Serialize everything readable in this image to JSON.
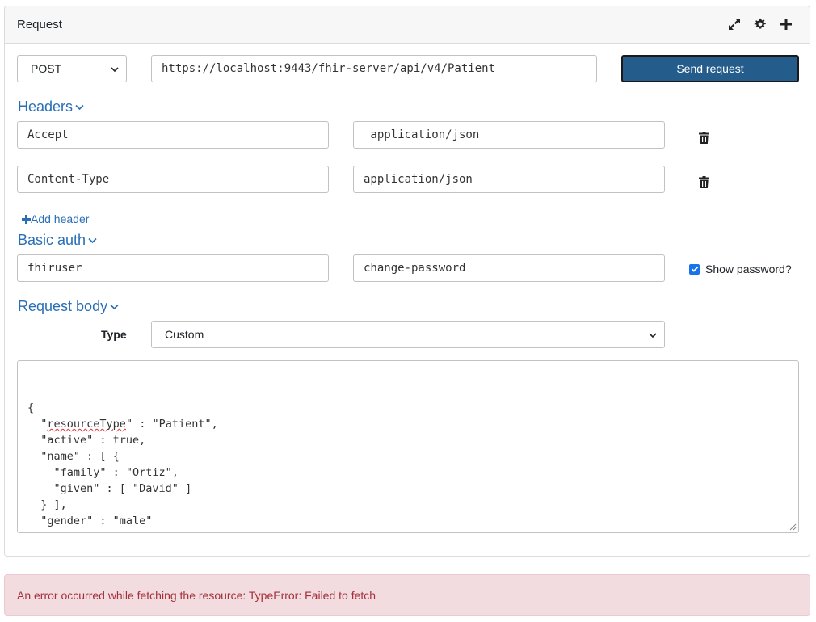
{
  "panel": {
    "title": "Request",
    "icons": [
      "expand-icon",
      "gear-icon",
      "plus-icon"
    ]
  },
  "request": {
    "method": "POST",
    "url": "https://localhost:9443/fhir-server/api/v4/Patient",
    "send_label": "Send request"
  },
  "headers": {
    "title": "Headers",
    "rows": [
      {
        "name": "Accept",
        "value": " application/json"
      },
      {
        "name": "Content-Type",
        "value": "application/json"
      }
    ],
    "add_label": "Add header"
  },
  "basic_auth": {
    "title": "Basic auth",
    "username": "fhiruser",
    "password": "change-password",
    "show_password_label": "Show password?",
    "show_password_checked": true
  },
  "request_body": {
    "title": "Request body",
    "type_label": "Type",
    "type_value": "Custom",
    "lines": [
      {
        "pre": "{",
        "spell": "",
        "post": ""
      },
      {
        "pre": "  \"",
        "spell": "resourceType",
        "post": "\" : \"Patient\","
      },
      {
        "pre": "  \"active\" : true,",
        "spell": "",
        "post": ""
      },
      {
        "pre": "  \"name\" : [ {",
        "spell": "",
        "post": ""
      },
      {
        "pre": "    \"family\" : \"Ortiz\",",
        "spell": "",
        "post": ""
      },
      {
        "pre": "    \"given\" : [ \"David\" ]",
        "spell": "",
        "post": ""
      },
      {
        "pre": "  } ],",
        "spell": "",
        "post": ""
      },
      {
        "pre": "  \"gender\" : \"male\"",
        "spell": "",
        "post": ""
      },
      {
        "pre": "}",
        "spell": "",
        "post": ""
      }
    ]
  },
  "error": {
    "message": "An error occurred while fetching the resource: TypeError: Failed to fetch"
  },
  "colors": {
    "accent": "#2a6fb6",
    "primary_button": "#245c8c",
    "error_bg": "#f3dcdf",
    "error_text": "#a3313c"
  }
}
